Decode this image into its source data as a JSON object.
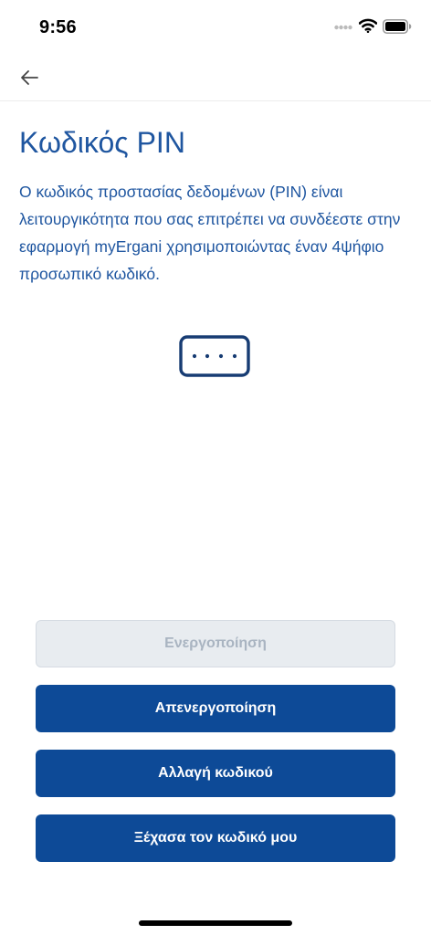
{
  "status_bar": {
    "time": "9:56"
  },
  "page": {
    "title": "Κωδικός PIN",
    "description": "Ο κωδικός προστασίας δεδομένων (PIN) είναι λειτουργικότητα που σας επιτρέπει να συνδέεστε στην εφαρμογή myErgani χρησιμοποιώντας έναν 4ψήφιο προσωπικό κωδικό."
  },
  "icons": {
    "back": "arrow-left-icon",
    "pin": "pin-dots-icon"
  },
  "buttons": {
    "activate": "Ενεργοποίηση",
    "deactivate": "Απενεργοποίηση",
    "change_code": "Αλλαγή κωδικού",
    "forgot_code": "Ξέχασα τον κωδικό μου"
  },
  "colors": {
    "title_text": "#1f56a0",
    "primary_button": "#0d4a97",
    "disabled_button": "#e8ecf0",
    "disabled_text": "#a9b4c1"
  }
}
